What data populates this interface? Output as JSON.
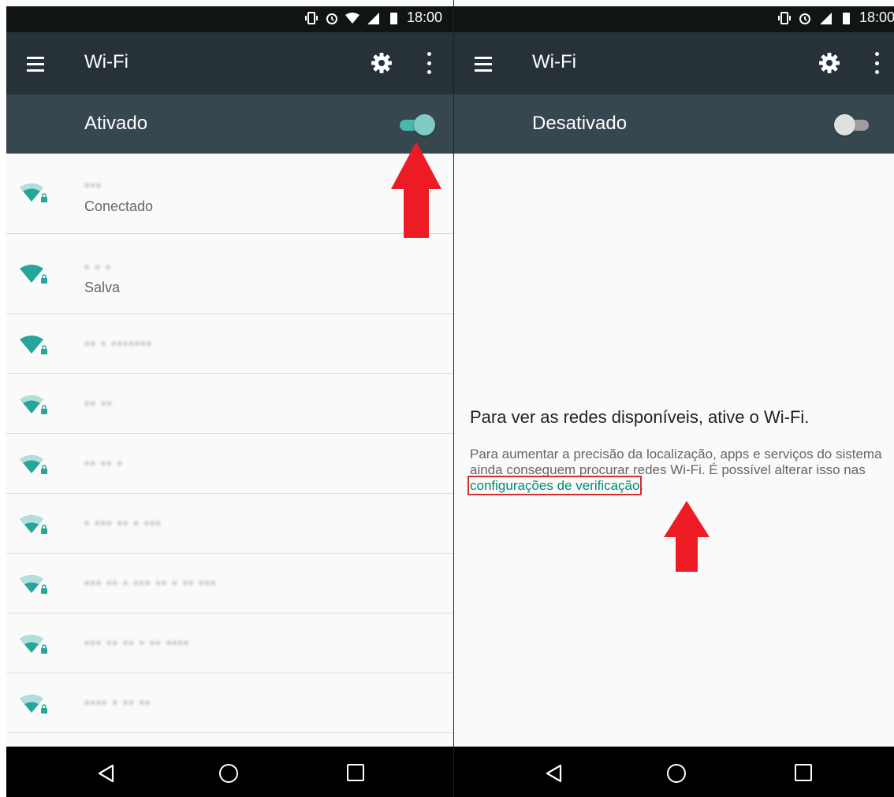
{
  "left": {
    "status_time": "18:00",
    "toolbar": {
      "title": "Wi-Fi"
    },
    "switch_label": "Ativado",
    "networks": [
      {
        "name": "▪▪▪",
        "status": "Conectado"
      },
      {
        "name": "▪ ▪ ▪",
        "status": "Salva"
      },
      {
        "name": "▪▪ ▪ ▪▪▪▪▪▪▪",
        "status": ""
      },
      {
        "name": "▪▪ ▪▪",
        "status": ""
      },
      {
        "name": "▪▪ ▪▪ ▪",
        "status": ""
      },
      {
        "name": "▪ ▪▪▪ ▪▪ ▪ ▪▪▪",
        "status": ""
      },
      {
        "name": "▪▪▪ ▪▪ ▪ ▪▪▪ ▪▪ ▪ ▪▪ ▪▪▪",
        "status": ""
      },
      {
        "name": "▪▪▪ ▪▪ ▪▪ ▪ ▪▪ ▪▪▪▪",
        "status": ""
      },
      {
        "name": "▪▪▪▪ ▪ ▪▪ ▪▪",
        "status": ""
      }
    ]
  },
  "right": {
    "status_time": "18:00",
    "toolbar": {
      "title": "Wi-Fi"
    },
    "switch_label": "Desativado",
    "empty_title": "Para ver as redes disponíveis, ative o Wi-Fi.",
    "empty_body_prefix": "Para aumentar a precisão da localização, apps e serviços do sistema ainda conseguem procurar redes Wi-Fi. É possível alterar isso nas ",
    "empty_body_link": "configurações de verificação",
    "empty_body_suffix": "."
  },
  "colors": {
    "toolbar": "#263238",
    "switchbar": "#37474f",
    "accent": "#00897b",
    "switch_on_thumb": "#80cbc4",
    "switch_on_track": "#4db6ac",
    "switch_off_thumb": "#e0e0e0",
    "switch_off_track": "#9e9e9e",
    "annotation_arrow": "#ed1c24"
  },
  "icons": [
    "menu-icon",
    "gear-icon",
    "overflow-menu-icon",
    "wifi-lock-icon",
    "back-icon",
    "home-icon",
    "recents-icon"
  ]
}
